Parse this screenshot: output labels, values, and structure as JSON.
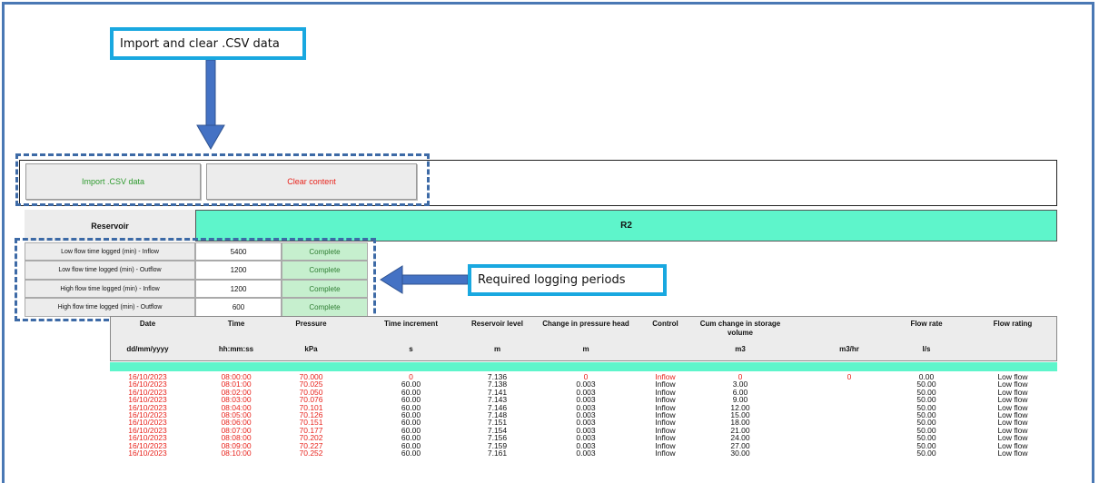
{
  "callouts": {
    "import_clear": "Import and clear .CSV data",
    "logging_periods": "Required logging periods"
  },
  "buttons": {
    "import": "Import .CSV data",
    "clear": "Clear content"
  },
  "reservoir": {
    "label": "Reservoir",
    "value": "R2"
  },
  "logging": [
    {
      "label": "Low flow time logged (min) - Inflow",
      "value": "5400",
      "status": "Complete"
    },
    {
      "label": "Low flow time logged (min) - Outflow",
      "value": "1200",
      "status": "Complete"
    },
    {
      "label": "High flow time logged (min) - Inflow",
      "value": "1200",
      "status": "Complete"
    },
    {
      "label": "High flow time logged (min) - Outflow",
      "value": "600",
      "status": "Complete"
    }
  ],
  "table": {
    "headers": [
      "Date",
      "Time",
      "Pressure",
      "Time increment",
      "Reservoir level",
      "Change in pressure head",
      "Control",
      "Cum change in storage volume",
      "",
      "Flow rate",
      "Flow rating"
    ],
    "units": [
      "dd/mm/yyyy",
      "hh:mm:ss",
      "kPa",
      "s",
      "m",
      "m",
      "",
      "m3",
      "m3/hr",
      "l/s",
      ""
    ],
    "dates": [
      "16/10/2023",
      "16/10/2023",
      "16/10/2023",
      "16/10/2023",
      "16/10/2023",
      "16/10/2023",
      "16/10/2023",
      "16/10/2023",
      "16/10/2023",
      "16/10/2023",
      "16/10/2023"
    ],
    "times": [
      "08:00:00",
      "08:01:00",
      "08:02:00",
      "08:03:00",
      "08:04:00",
      "08:05:00",
      "08:06:00",
      "08:07:00",
      "08:08:00",
      "08:09:00",
      "08:10:00"
    ],
    "pressures": [
      "70.000",
      "70.025",
      "70.050",
      "70.076",
      "70.101",
      "70.126",
      "70.151",
      "70.177",
      "70.202",
      "70.227",
      "70.252"
    ],
    "increments": [
      "0",
      "60.00",
      "60.00",
      "60.00",
      "60.00",
      "60.00",
      "60.00",
      "60.00",
      "60.00",
      "60.00",
      "60.00"
    ],
    "levels": [
      "7.136",
      "7.138",
      "7.141",
      "7.143",
      "7.146",
      "7.148",
      "7.151",
      "7.154",
      "7.156",
      "7.159",
      "7.161"
    ],
    "head_changes": [
      "0",
      "0.003",
      "0.003",
      "0.003",
      "0.003",
      "0.003",
      "0.003",
      "0.003",
      "0.003",
      "0.003",
      "0.003"
    ],
    "controls": [
      "Inflow",
      "Inflow",
      "Inflow",
      "Inflow",
      "Inflow",
      "Inflow",
      "Inflow",
      "Inflow",
      "Inflow",
      "Inflow",
      "Inflow"
    ],
    "cum_storage": [
      "0",
      "3.00",
      "6.00",
      "9.00",
      "12.00",
      "15.00",
      "18.00",
      "21.00",
      "24.00",
      "27.00",
      "30.00"
    ],
    "m3hr_first": "0",
    "flow_rates": [
      "0.00",
      "50.00",
      "50.00",
      "50.00",
      "50.00",
      "50.00",
      "50.00",
      "50.00",
      "50.00",
      "50.00",
      "50.00"
    ],
    "ratings": [
      "Low flow",
      "Low flow",
      "Low flow",
      "Low flow",
      "Low flow",
      "Low flow",
      "Low flow",
      "Low flow",
      "Low flow",
      "Low flow",
      "Low flow"
    ]
  },
  "colors": {
    "accent_teal": "#5ef5cb",
    "complete_green": "#c6efce",
    "callout_border": "#19a8e0",
    "arrow_blue": "#4472c4",
    "red_text": "#e8231c",
    "green_text": "#2e9a2e"
  }
}
